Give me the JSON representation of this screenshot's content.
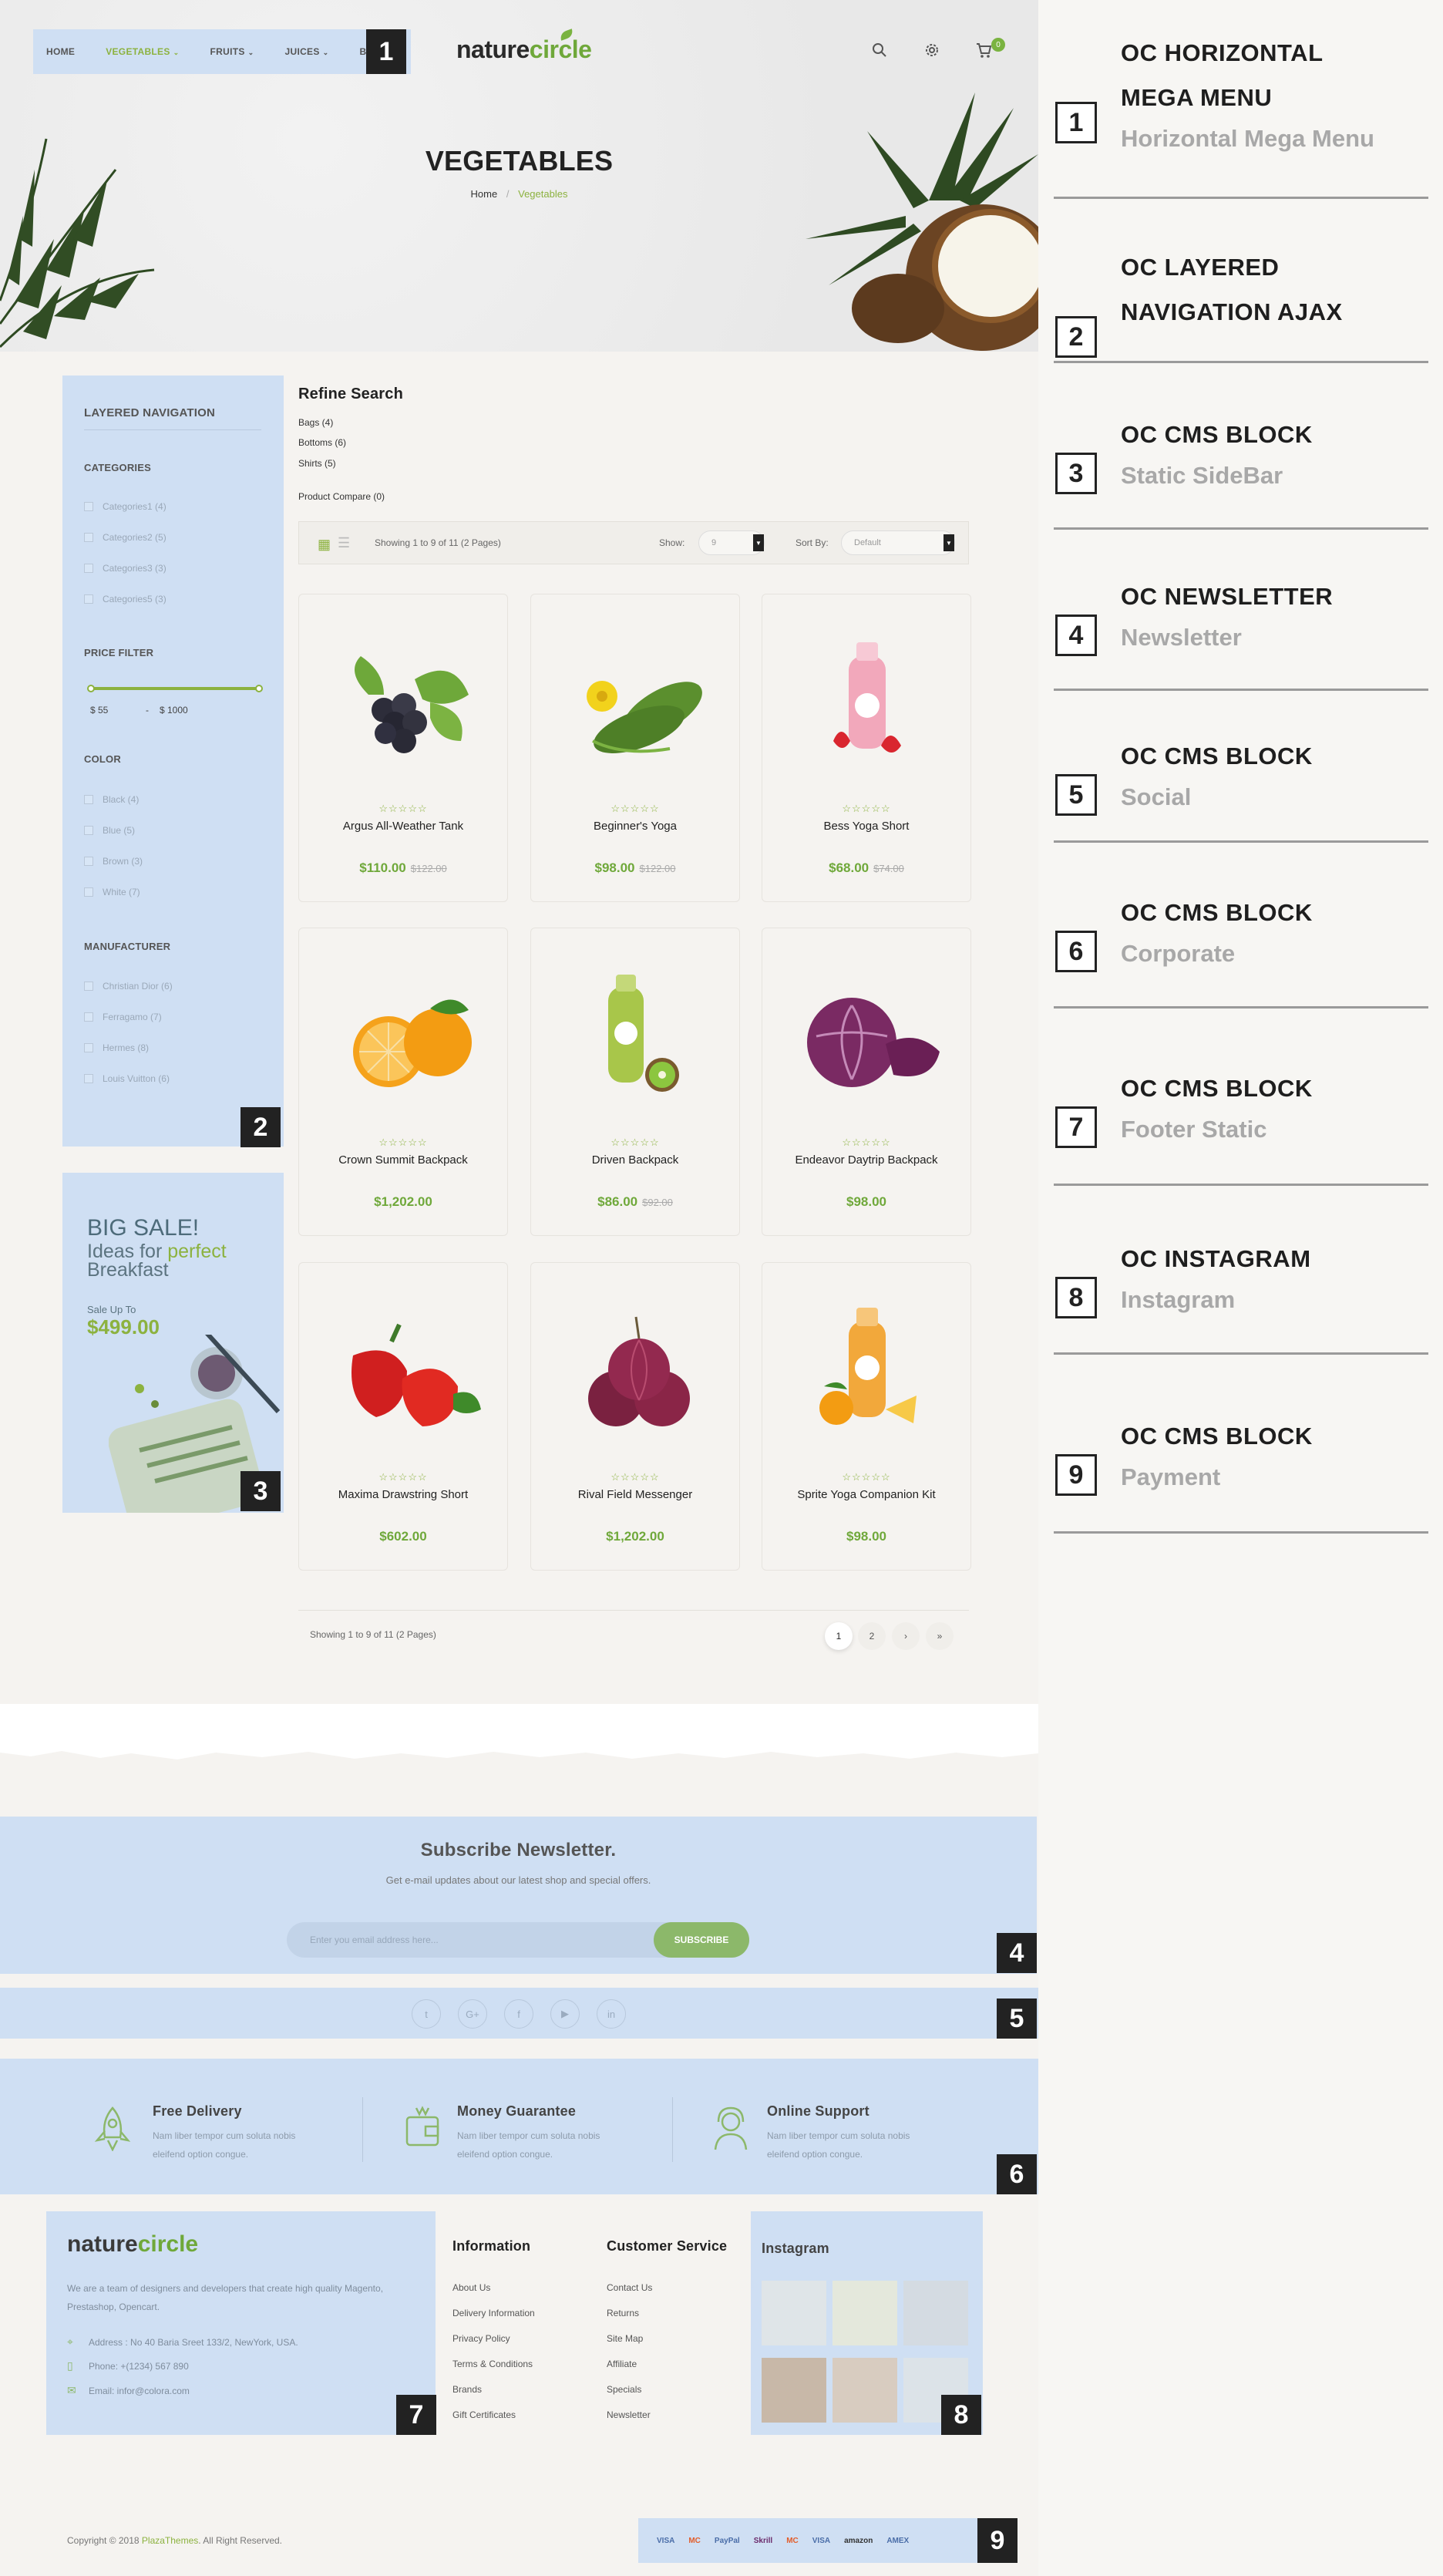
{
  "nav": {
    "items": [
      {
        "label": "HOME",
        "caret": false,
        "active": false
      },
      {
        "label": "VEGETABLES",
        "caret": true,
        "active": true
      },
      {
        "label": "FRUITS",
        "caret": true,
        "active": false
      },
      {
        "label": "JUICES",
        "caret": true,
        "active": false
      },
      {
        "label": "BLOG",
        "caret": false,
        "active": false
      }
    ]
  },
  "header": {
    "logo_part1": "nature",
    "logo_part2": "circle",
    "cart_count": "0"
  },
  "hero": {
    "title": "VEGETABLES",
    "breadcrumb_home": "Home",
    "breadcrumb_sep": "/",
    "breadcrumb_current": "Vegetables"
  },
  "sidebar": {
    "title": "LAYERED NAVIGATION",
    "categories_title": "CATEGORIES",
    "categories": [
      "Categories1 (4)",
      "Categories2 (5)",
      "Categories3 (3)",
      "Categories5 (3)"
    ],
    "price_title": "PRICE FILTER",
    "price_min": "$ 55",
    "price_dash": "-",
    "price_max": "$ 1000",
    "color_title": "COLOR",
    "colors": [
      "Black (4)",
      "Blue (5)",
      "Brown (3)",
      "White (7)"
    ],
    "manufacturer_title": "MANUFACTURER",
    "manufacturers": [
      "Christian Dior (6)",
      "Ferragamo (7)",
      "Hermes (8)",
      "Louis Vuitton (6)"
    ]
  },
  "banner": {
    "title": "BIG SALE!",
    "sub1_a": "Ideas for ",
    "sub1_b": "perfect",
    "sub2": "Breakfast",
    "sale_label": "Sale Up To",
    "sale_price": "$499.00"
  },
  "main": {
    "refine_title": "Refine Search",
    "refine_links": [
      "Bags (4)",
      "Bottoms (6)",
      "Shirts (5)"
    ],
    "compare_link": "Product Compare (0)",
    "showing": "Showing 1 to 9 of 11 (2 Pages)",
    "show_label": "Show:",
    "show_value": "9",
    "sort_label": "Sort By:",
    "sort_value": "Default",
    "stars": "☆☆☆☆☆",
    "products": [
      {
        "name": "Argus All-Weather Tank",
        "price": "$110.00",
        "old_price": "$122.00",
        "image": "grapes"
      },
      {
        "name": "Beginner's Yoga",
        "price": "$98.00",
        "old_price": "$122.00",
        "image": "cucumber"
      },
      {
        "name": "Bess Yoga Short",
        "price": "$68.00",
        "old_price": "$74.00",
        "image": "strawberry-juice"
      },
      {
        "name": "Crown Summit Backpack",
        "price": "$1,202.00",
        "old_price": "",
        "image": "oranges"
      },
      {
        "name": "Driven Backpack",
        "price": "$86.00",
        "old_price": "$92.00",
        "image": "kiwi-juice"
      },
      {
        "name": "Endeavor Daytrip Backpack",
        "price": "$98.00",
        "old_price": "",
        "image": "red-cabbage"
      },
      {
        "name": "Maxima Drawstring Short",
        "price": "$602.00",
        "old_price": "",
        "image": "red-peppers"
      },
      {
        "name": "Rival Field Messenger",
        "price": "$1,202.00",
        "old_price": "",
        "image": "red-onions"
      },
      {
        "name": "Sprite Yoga Companion Kit",
        "price": "$98.00",
        "old_price": "",
        "image": "orange-juice"
      }
    ],
    "pager_text": "Showing 1 to 9 of 11 (2 Pages)",
    "pages": [
      "1",
      "2",
      "›",
      "»"
    ]
  },
  "newsletter": {
    "title": "Subscribe Newsletter.",
    "subtitle": "Get e-mail updates about our latest shop and special offers.",
    "placeholder": "Enter you email address here...",
    "button": "SUBSCRIBE"
  },
  "social": [
    "twitter-icon",
    "google-plus-icon",
    "facebook-icon",
    "youtube-icon",
    "linkedin-icon"
  ],
  "corporate": [
    {
      "title": "Free Delivery",
      "desc1": "Nam liber tempor cum soluta nobis",
      "desc2": "eleifend option congue.",
      "icon": "rocket-icon"
    },
    {
      "title": "Money Guarantee",
      "desc1": "Nam liber tempor cum soluta nobis",
      "desc2": "eleifend option congue.",
      "icon": "wallet-icon"
    },
    {
      "title": "Online Support",
      "desc1": "Nam liber tempor cum soluta nobis",
      "desc2": "eleifend option congue.",
      "icon": "support-icon"
    }
  ],
  "footer": {
    "logo_part1": "nature",
    "logo_part2": "circle",
    "desc": "We are a team of designers and developers that create high quality Magento, Prestashop, Opencart.",
    "address": "Address : No 40 Baria Sreet 133/2, NewYork, USA.",
    "phone": "Phone: +(1234) 567 890",
    "email": "Email: infor@colora.com",
    "info_title": "Information",
    "info_links": [
      "About Us",
      "Delivery Information",
      "Privacy Policy",
      "Terms & Conditions",
      "Brands",
      "Gift Certificates"
    ],
    "service_title": "Customer Service",
    "service_links": [
      "Contact Us",
      "Returns",
      "Site Map",
      "Affiliate",
      "Specials",
      "Newsletter"
    ],
    "instagram_title": "Instagram",
    "copyright_a": "Copyright © 2018 ",
    "copyright_b": "PlazaThemes",
    "copyright_c": ". All Right Reserved.",
    "payments": [
      "VISA",
      "MC",
      "PayPal",
      "Skrill",
      "MC",
      "VISA",
      "amazon",
      "AMEX"
    ]
  },
  "badges": [
    "1",
    "2",
    "3",
    "4",
    "5",
    "6",
    "7",
    "8",
    "9"
  ],
  "legend": [
    {
      "num": "1",
      "title1": "OC HORIZONTAL",
      "title2": "MEGA MENU",
      "sub": "Horizontal Mega Menu"
    },
    {
      "num": "2",
      "title1": "OC LAYERED",
      "title2": "NAVIGATION AJAX",
      "sub": ""
    },
    {
      "num": "3",
      "title1": "OC CMS BLOCK",
      "title2": "",
      "sub": "Static SideBar"
    },
    {
      "num": "4",
      "title1": "OC NEWSLETTER",
      "title2": "",
      "sub": "Newsletter"
    },
    {
      "num": "5",
      "title1": "OC CMS BLOCK",
      "title2": "",
      "sub": "Social"
    },
    {
      "num": "6",
      "title1": "OC CMS BLOCK",
      "title2": "",
      "sub": "Corporate"
    },
    {
      "num": "7",
      "title1": "OC CMS BLOCK",
      "title2": "",
      "sub": "Footer Static"
    },
    {
      "num": "8",
      "title1": "OC INSTAGRAM",
      "title2": "",
      "sub": "Instagram"
    },
    {
      "num": "9",
      "title1": "OC CMS BLOCK",
      "title2": "",
      "sub": "Payment"
    }
  ],
  "colors": {
    "accent": "#8cb23f",
    "highlight_block": "#cfdff3",
    "badge": "#222222"
  }
}
